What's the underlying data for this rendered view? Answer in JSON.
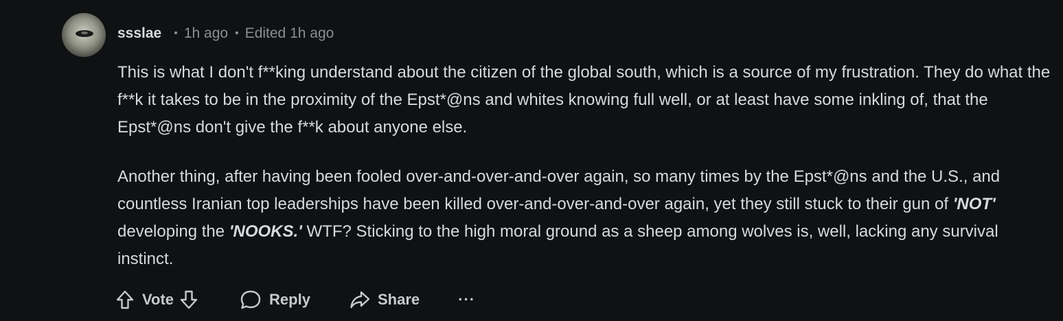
{
  "comment": {
    "author": "ssslae",
    "separator": "•",
    "time": "1h ago",
    "edited": "Edited 1h ago",
    "paragraphs": [
      {
        "before": "This is what I don't f**king understand about the citizen of the global south, which is a source of my frustration. They do what the f**k it takes to be in the proximity of the Epst*@ns and whites knowing full well, or at least have some inkling of, that the Epst*@ns don't give the f**k about anyone else."
      },
      {
        "before": "Another thing, after having been fooled over-and-over-and-over again, so many times by the Epst*@ns and the U.S., and countless Iranian top leaderships have been killed over-and-over-and-over again, yet they still stuck to their gun of ",
        "emph1": "'NOT'",
        "middle": " developing the ",
        "emph2": "'NOOKS.'",
        "after": " WTF? Sticking to the high moral ground as a sheep among wolves is, well, lacking any survival instinct."
      }
    ]
  },
  "actions": {
    "upvote_icon": "arrow-up-icon",
    "vote_label": "Vote",
    "downvote_icon": "arrow-down-icon",
    "reply_icon": "speech-bubble-icon",
    "reply_label": "Reply",
    "share_icon": "share-arrow-icon",
    "share_label": "Share",
    "more_label": "···"
  },
  "colors": {
    "background": "#0f1113",
    "text": "#d7dadc",
    "muted": "#8b8f92"
  }
}
